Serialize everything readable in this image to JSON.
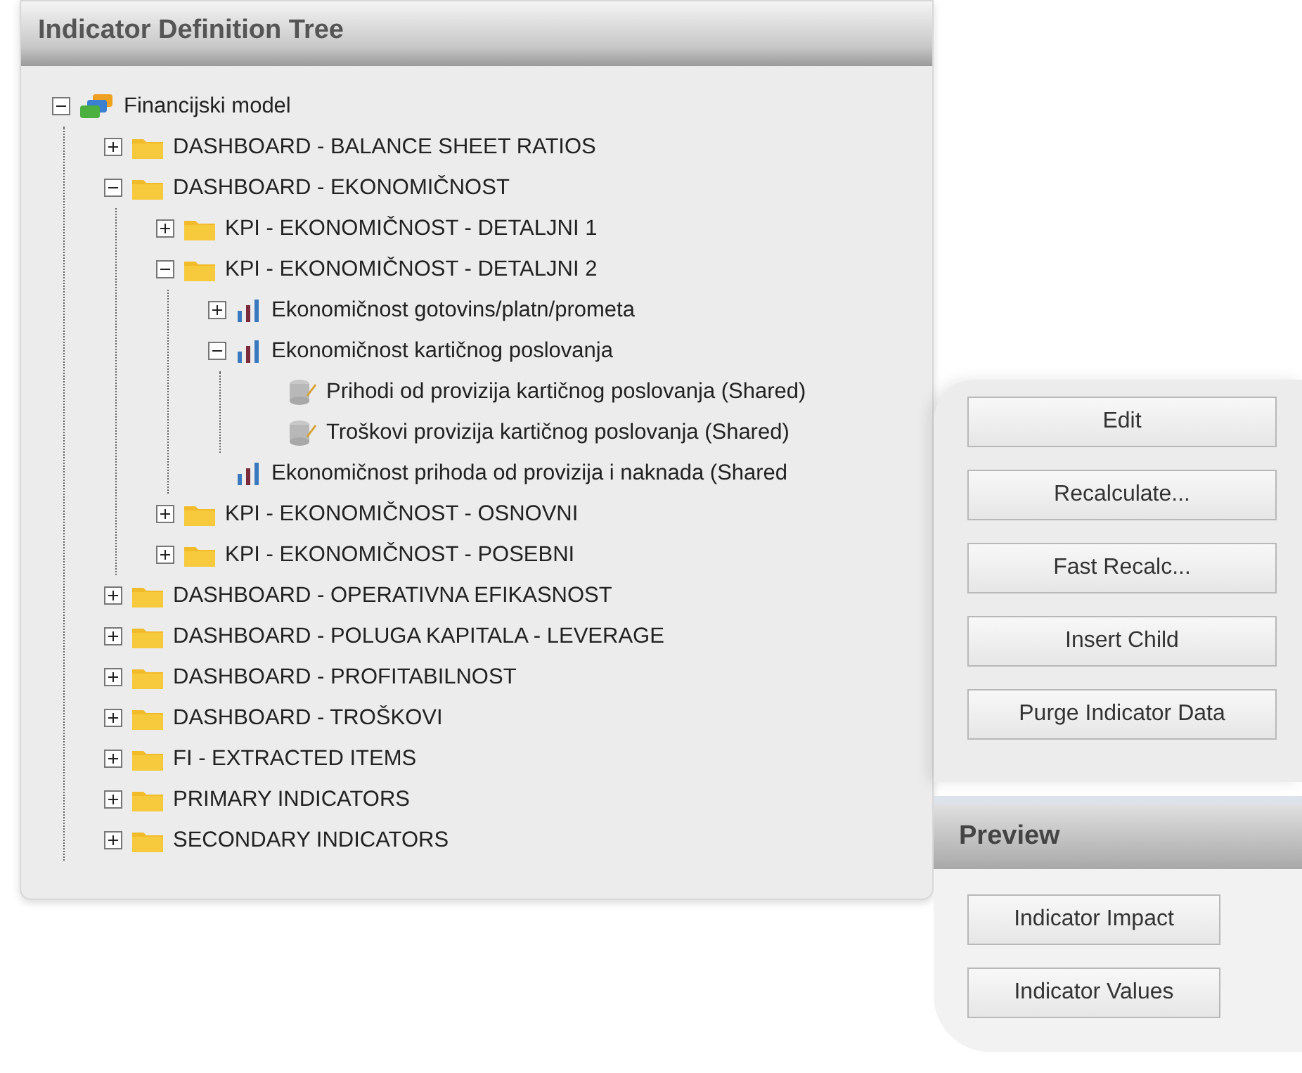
{
  "tree_panel": {
    "title": "Indicator Definition Tree",
    "root": {
      "label": "Financijski model",
      "kind": "model",
      "expanded": true,
      "children": [
        {
          "label": "DASHBOARD - BALANCE SHEET RATIOS",
          "kind": "folder",
          "expanded": false
        },
        {
          "label": "DASHBOARD - EKONOMIČNOST",
          "kind": "folder",
          "expanded": true,
          "children": [
            {
              "label": "KPI - EKONOMIČNOST - DETALJNI 1",
              "kind": "folder",
              "expanded": false
            },
            {
              "label": "KPI - EKONOMIČNOST - DETALJNI 2",
              "kind": "folder",
              "expanded": true,
              "children": [
                {
                  "label": "Ekonomičnost gotovins/platn/prometa",
                  "kind": "indicator",
                  "expanded": false
                },
                {
                  "label": "Ekonomičnost kartičnog poslovanja",
                  "kind": "indicator",
                  "expanded": true,
                  "children": [
                    {
                      "label": "Prihodi od provizija kartičnog poslovanja (Shared)",
                      "kind": "shared"
                    },
                    {
                      "label": "Troškovi provizija kartičnog poslovanja (Shared)",
                      "kind": "shared"
                    }
                  ]
                },
                {
                  "label": "Ekonomičnost prihoda od provizija i naknada (Shared",
                  "kind": "indicator"
                }
              ]
            },
            {
              "label": "KPI - EKONOMIČNOST - OSNOVNI",
              "kind": "folder",
              "expanded": false
            },
            {
              "label": "KPI - EKONOMIČNOST - POSEBNI",
              "kind": "folder",
              "expanded": false
            }
          ]
        },
        {
          "label": "DASHBOARD - OPERATIVNA EFIKASNOST",
          "kind": "folder",
          "expanded": false
        },
        {
          "label": "DASHBOARD - POLUGA KAPITALA - LEVERAGE",
          "kind": "folder",
          "expanded": false
        },
        {
          "label": "DASHBOARD - PROFITABILNOST",
          "kind": "folder",
          "expanded": false
        },
        {
          "label": "DASHBOARD - TROŠKOVI",
          "kind": "folder",
          "expanded": false
        },
        {
          "label": "FI - EXTRACTED ITEMS",
          "kind": "folder",
          "expanded": false
        },
        {
          "label": "PRIMARY INDICATORS",
          "kind": "folder",
          "expanded": false
        },
        {
          "label": "SECONDARY INDICATORS",
          "kind": "folder",
          "expanded": false
        }
      ]
    }
  },
  "actions": [
    "Edit",
    "Recalculate...",
    "Fast Recalc...",
    "Insert Child",
    "Purge Indicator Data"
  ],
  "preview": {
    "title": "Preview",
    "buttons": [
      "Indicator Impact",
      "Indicator Values"
    ]
  }
}
